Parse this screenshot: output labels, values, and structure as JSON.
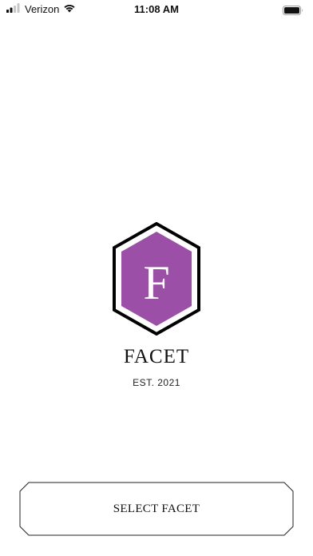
{
  "status_bar": {
    "carrier": "Verizon",
    "time": "11:08 AM",
    "icons": [
      "signal-icon",
      "wifi-icon",
      "battery-icon"
    ]
  },
  "brand": {
    "logo_letter": "F",
    "name": "FACET",
    "established": "EST. 2021",
    "colors": {
      "hexagon_fill": "#9b4fa6",
      "hexagon_outline": "#000000",
      "letter": "#ffffff"
    }
  },
  "actions": {
    "select_label": "SELECT FACET"
  }
}
